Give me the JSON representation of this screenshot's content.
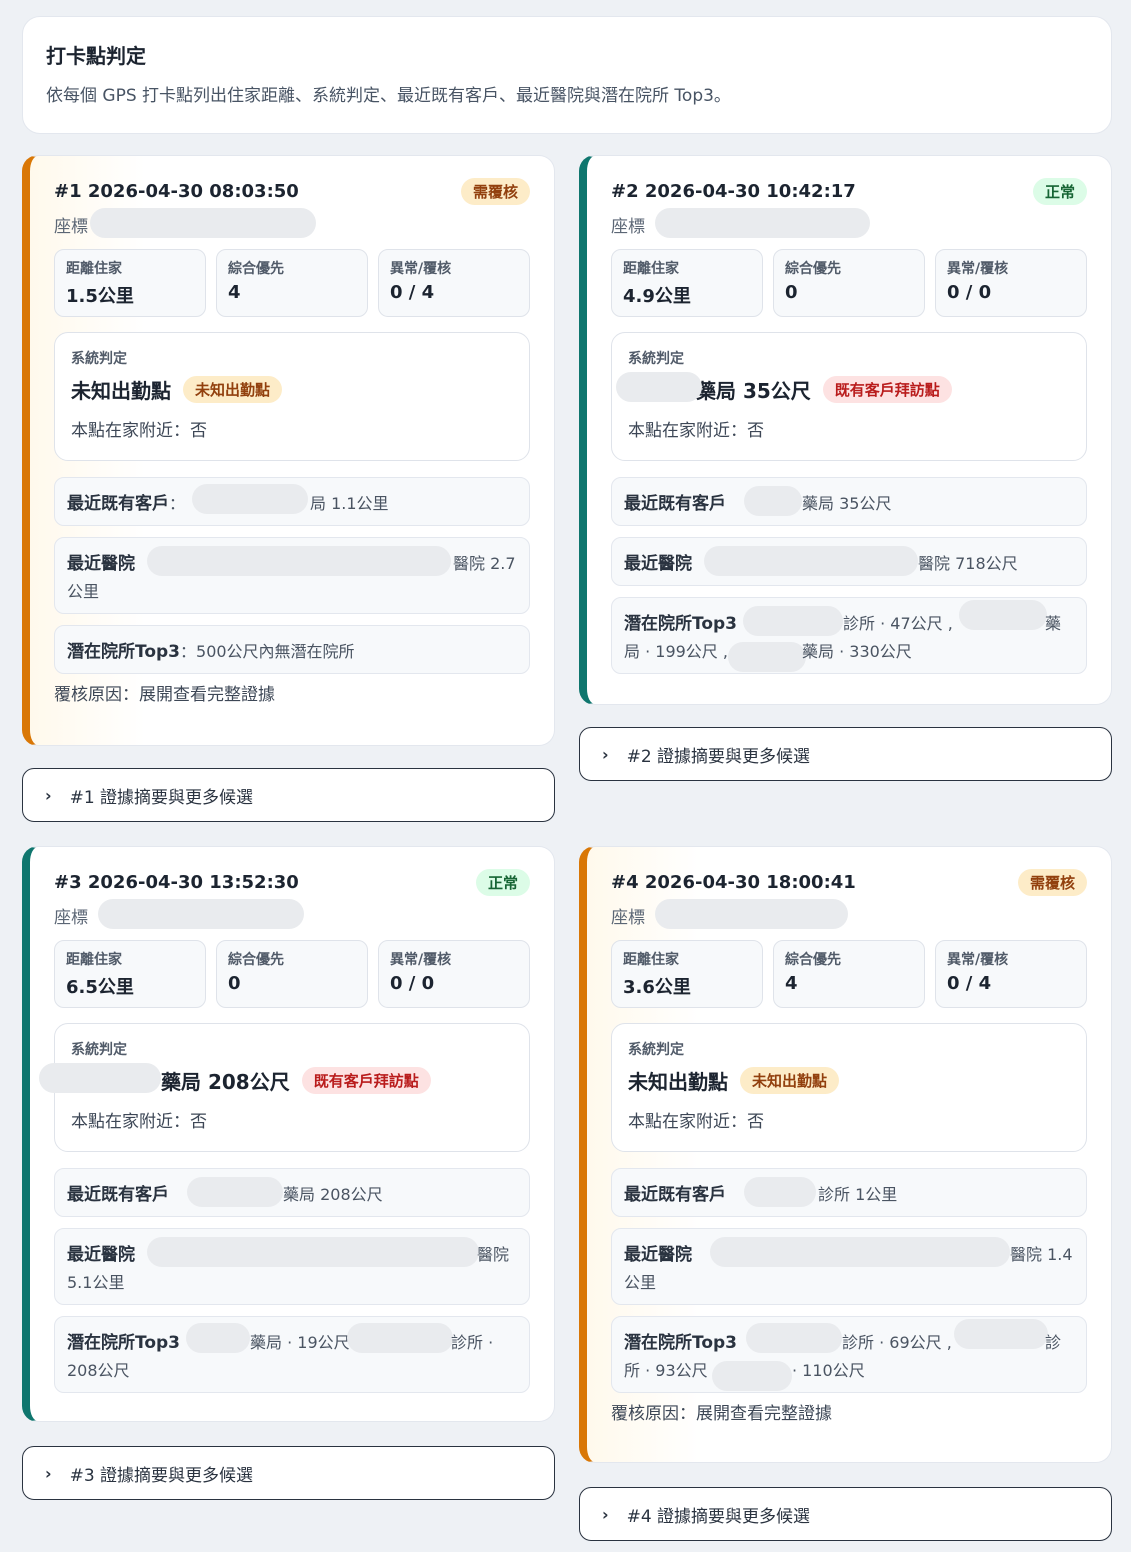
{
  "header": {
    "title": "打卡點判定",
    "subtitle": "依每個 GPS 打卡點列出住家距離、系統判定、最近既有客戶、最近醫院與潛在院所 Top3。"
  },
  "labels": {
    "coord": "座標",
    "dist_home": "距離住家",
    "priority": "綜合優先",
    "abnormal": "異常/覆核",
    "system_verdict": "系統判定",
    "near_customer": "最近既有客戶",
    "near_hospital": "最近醫院",
    "potential": "潛在院所Top3",
    "reason_prefix": "覆核原因：",
    "reason_text": "展開查看完整證據"
  },
  "cards": [
    {
      "title": "#1 2026-04-30 08:03:50",
      "status": "需覆核",
      "coord_suffix": "",
      "dist_home": "1.5公里",
      "priority": "4",
      "abnormal": "0 / 4",
      "verdict_main": "未知出勤點",
      "verdict_tag": "未知出勤點",
      "near_home": "本點在家附近：否",
      "customer_prefix": "：",
      "customer_tail": "局 1.1公里",
      "hospital_tail": "醫院 2.7",
      "hospital_tail2": "公里",
      "potential": "：500公尺內無潛在院所",
      "reason": "覆核原因：展開查看完整證據",
      "toggle": "#1 證據摘要與更多候選"
    },
    {
      "title": "#2 2026-04-30 10:42:17",
      "status": "正常",
      "dist_home": "4.9公里",
      "priority": "0",
      "abnormal": "0 / 0",
      "verdict_main": "藥局 35公尺",
      "verdict_tag": "既有客戶拜訪點",
      "near_home": "本點在家附近：否",
      "customer_tail": "藥局 35公尺",
      "hospital_tail": "醫院 718公尺",
      "potential_a": "診所 · 47公尺 ,",
      "potential_b": "藥",
      "potential_c": "局 · 199公尺 ,",
      "potential_d": "藥局 · 330公尺",
      "toggle": "#2 證據摘要與更多候選"
    },
    {
      "title": "#3 2026-04-30 13:52:30",
      "status": "正常",
      "dist_home": "6.5公里",
      "priority": "0",
      "abnormal": "0 / 0",
      "verdict_main": "藥局 208公尺",
      "verdict_tag": "既有客戶拜訪點",
      "near_home": "本點在家附近：否",
      "customer_tail": "藥局 208公尺",
      "hospital_tail": "醫院",
      "hospital_tail2": "5.1公里",
      "potential_a": "藥局 · 19公尺",
      "potential_b": "診所 ·",
      "potential_c": "208公尺",
      "toggle": "#3 證據摘要與更多候選"
    },
    {
      "title": "#4 2026-04-30 18:00:41",
      "status": "需覆核",
      "dist_home": "3.6公里",
      "priority": "4",
      "abnormal": "0 / 4",
      "verdict_main": "未知出勤點",
      "verdict_tag": "未知出勤點",
      "near_home": "本點在家附近：否",
      "customer_tail": "診所 1公里",
      "hospital_tail": "醫院 1.4",
      "hospital_tail2": "公里",
      "potential_a": "診所 · 69公尺 ,",
      "potential_b": "診",
      "potential_c": "所 · 93公尺",
      "potential_d": "· 110公尺",
      "reason": "覆核原因：展開查看完整證據",
      "toggle": "#4 證據摘要與更多候選"
    }
  ]
}
